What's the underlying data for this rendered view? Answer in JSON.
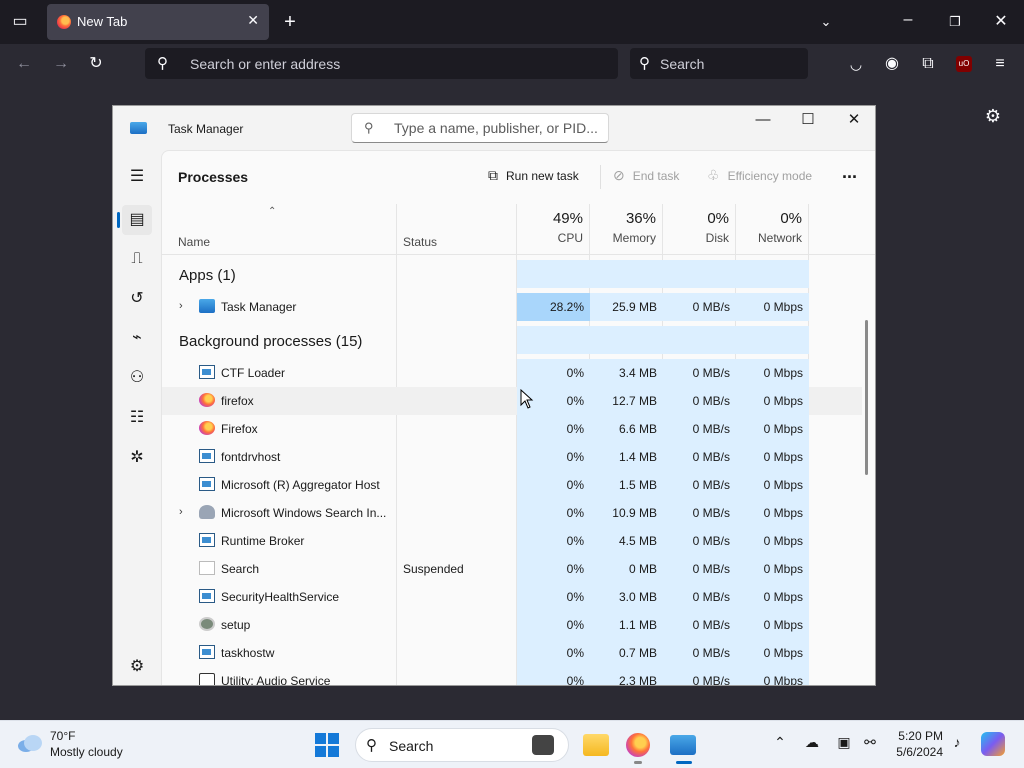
{
  "browser": {
    "tab_title": "New Tab",
    "address_placeholder": "Search or enter address",
    "search_placeholder": "Search",
    "addon_badge": "uO"
  },
  "task_manager": {
    "title": "Task Manager",
    "search_placeholder": "Type a name, publisher, or PID...",
    "page_title": "Processes",
    "commands": {
      "run_new_task": "Run new task",
      "end_task": "End task",
      "efficiency_mode": "Efficiency mode",
      "more": "..."
    },
    "columns": {
      "name": "Name",
      "status": "Status",
      "cpu_pct": "49%",
      "cpu_label": "CPU",
      "memory_pct": "36%",
      "memory_label": "Memory",
      "disk_pct": "0%",
      "disk_label": "Disk",
      "network_pct": "0%",
      "network_label": "Network"
    },
    "apps_group": "Apps (1)",
    "apps": [
      {
        "name": "Task Manager",
        "icon": "task-manager-icon",
        "status": "",
        "cpu": "28.2%",
        "memory": "25.9 MB",
        "disk": "0 MB/s",
        "network": "0 Mbps"
      }
    ],
    "bg_group": "Background processes (15)",
    "background": [
      {
        "name": "CTF Loader",
        "icon": "window-icon",
        "status": "",
        "cpu": "0%",
        "memory": "3.4 MB",
        "disk": "0 MB/s",
        "network": "0 Mbps"
      },
      {
        "name": "firefox",
        "icon": "firefox-icon",
        "status": "",
        "cpu": "0%",
        "memory": "12.7 MB",
        "disk": "0 MB/s",
        "network": "0 Mbps"
      },
      {
        "name": "Firefox",
        "icon": "firefox-icon",
        "status": "",
        "cpu": "0%",
        "memory": "6.6 MB",
        "disk": "0 MB/s",
        "network": "0 Mbps"
      },
      {
        "name": "fontdrvhost",
        "icon": "window-icon",
        "status": "",
        "cpu": "0%",
        "memory": "1.4 MB",
        "disk": "0 MB/s",
        "network": "0 Mbps"
      },
      {
        "name": "Microsoft (R) Aggregator Host",
        "icon": "window-icon",
        "status": "",
        "cpu": "0%",
        "memory": "1.5 MB",
        "disk": "0 MB/s",
        "network": "0 Mbps"
      },
      {
        "name": "Microsoft Windows Search In...",
        "icon": "user-icon",
        "status": "",
        "cpu": "0%",
        "memory": "10.9 MB",
        "disk": "0 MB/s",
        "network": "0 Mbps"
      },
      {
        "name": "Runtime Broker",
        "icon": "window-icon",
        "status": "",
        "cpu": "0%",
        "memory": "4.5 MB",
        "disk": "0 MB/s",
        "network": "0 Mbps"
      },
      {
        "name": "Search",
        "icon": "search-app-icon",
        "status": "Suspended",
        "cpu": "0%",
        "memory": "0 MB",
        "disk": "0 MB/s",
        "network": "0 Mbps"
      },
      {
        "name": "SecurityHealthService",
        "icon": "window-icon",
        "status": "",
        "cpu": "0%",
        "memory": "3.0 MB",
        "disk": "0 MB/s",
        "network": "0 Mbps"
      },
      {
        "name": "setup",
        "icon": "setup-icon",
        "status": "",
        "cpu": "0%",
        "memory": "1.1 MB",
        "disk": "0 MB/s",
        "network": "0 Mbps"
      },
      {
        "name": "taskhostw",
        "icon": "window-icon",
        "status": "",
        "cpu": "0%",
        "memory": "0.7 MB",
        "disk": "0 MB/s",
        "network": "0 Mbps"
      },
      {
        "name": "Utility: Audio Service",
        "icon": "briefcase-icon",
        "status": "",
        "cpu": "0%",
        "memory": "2.3 MB",
        "disk": "0 MB/s",
        "network": "0 Mbps"
      }
    ]
  },
  "taskbar": {
    "weather_temp": "70°F",
    "weather_desc": "Mostly cloudy",
    "search_label": "Search",
    "time": "5:20 PM",
    "date": "5/6/2024"
  },
  "colors": {
    "accent": "#0067c0",
    "cpu_hot": "#a9d6fb",
    "cpu_cell": "#dcefff"
  }
}
